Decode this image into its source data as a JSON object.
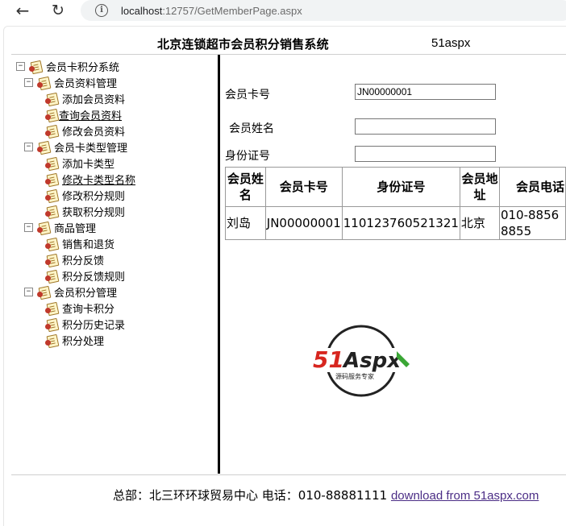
{
  "browser": {
    "url_host": "localhost",
    "url_rest": ":12757/GetMemberPage.aspx"
  },
  "header": {
    "title": "北京连锁超市会员积分销售系统",
    "brand": "51aspx"
  },
  "tree": {
    "root": "会员卡积分系统",
    "groups": [
      {
        "label": "会员资料管理",
        "items": [
          "添加会员资料",
          "查询会员资料",
          "修改会员资料"
        ]
      },
      {
        "label": "会员卡类型管理",
        "items": [
          "添加卡类型",
          "修改卡类型名称",
          "修改积分规则",
          "获取积分规则"
        ]
      },
      {
        "label": "商品管理",
        "items": [
          "销售和退货",
          "积分反馈",
          "积分反馈规则"
        ]
      },
      {
        "label": "会员积分管理",
        "items": [
          "查询卡积分",
          "积分历史记录",
          "积分处理"
        ]
      }
    ]
  },
  "form": {
    "card_label": "会员卡号",
    "card_value": "JN00000001",
    "name_label": "会员姓名",
    "name_value": "",
    "id_label": "身份证号",
    "id_value": ""
  },
  "grid": {
    "headers": [
      "会员姓名",
      "会员卡号",
      "身份证号",
      "会员地址",
      "会员电话"
    ],
    "rows": [
      [
        "刘岛",
        "JN00000001",
        "110123760521321",
        "北京",
        "010-88568855"
      ]
    ]
  },
  "logo": {
    "text": "51Aspx",
    "sub": "源码服务专家"
  },
  "footer": {
    "text": "总部：北三环环球贸易中心 电话：010-88881111 ",
    "link": "download from 51aspx.com"
  }
}
